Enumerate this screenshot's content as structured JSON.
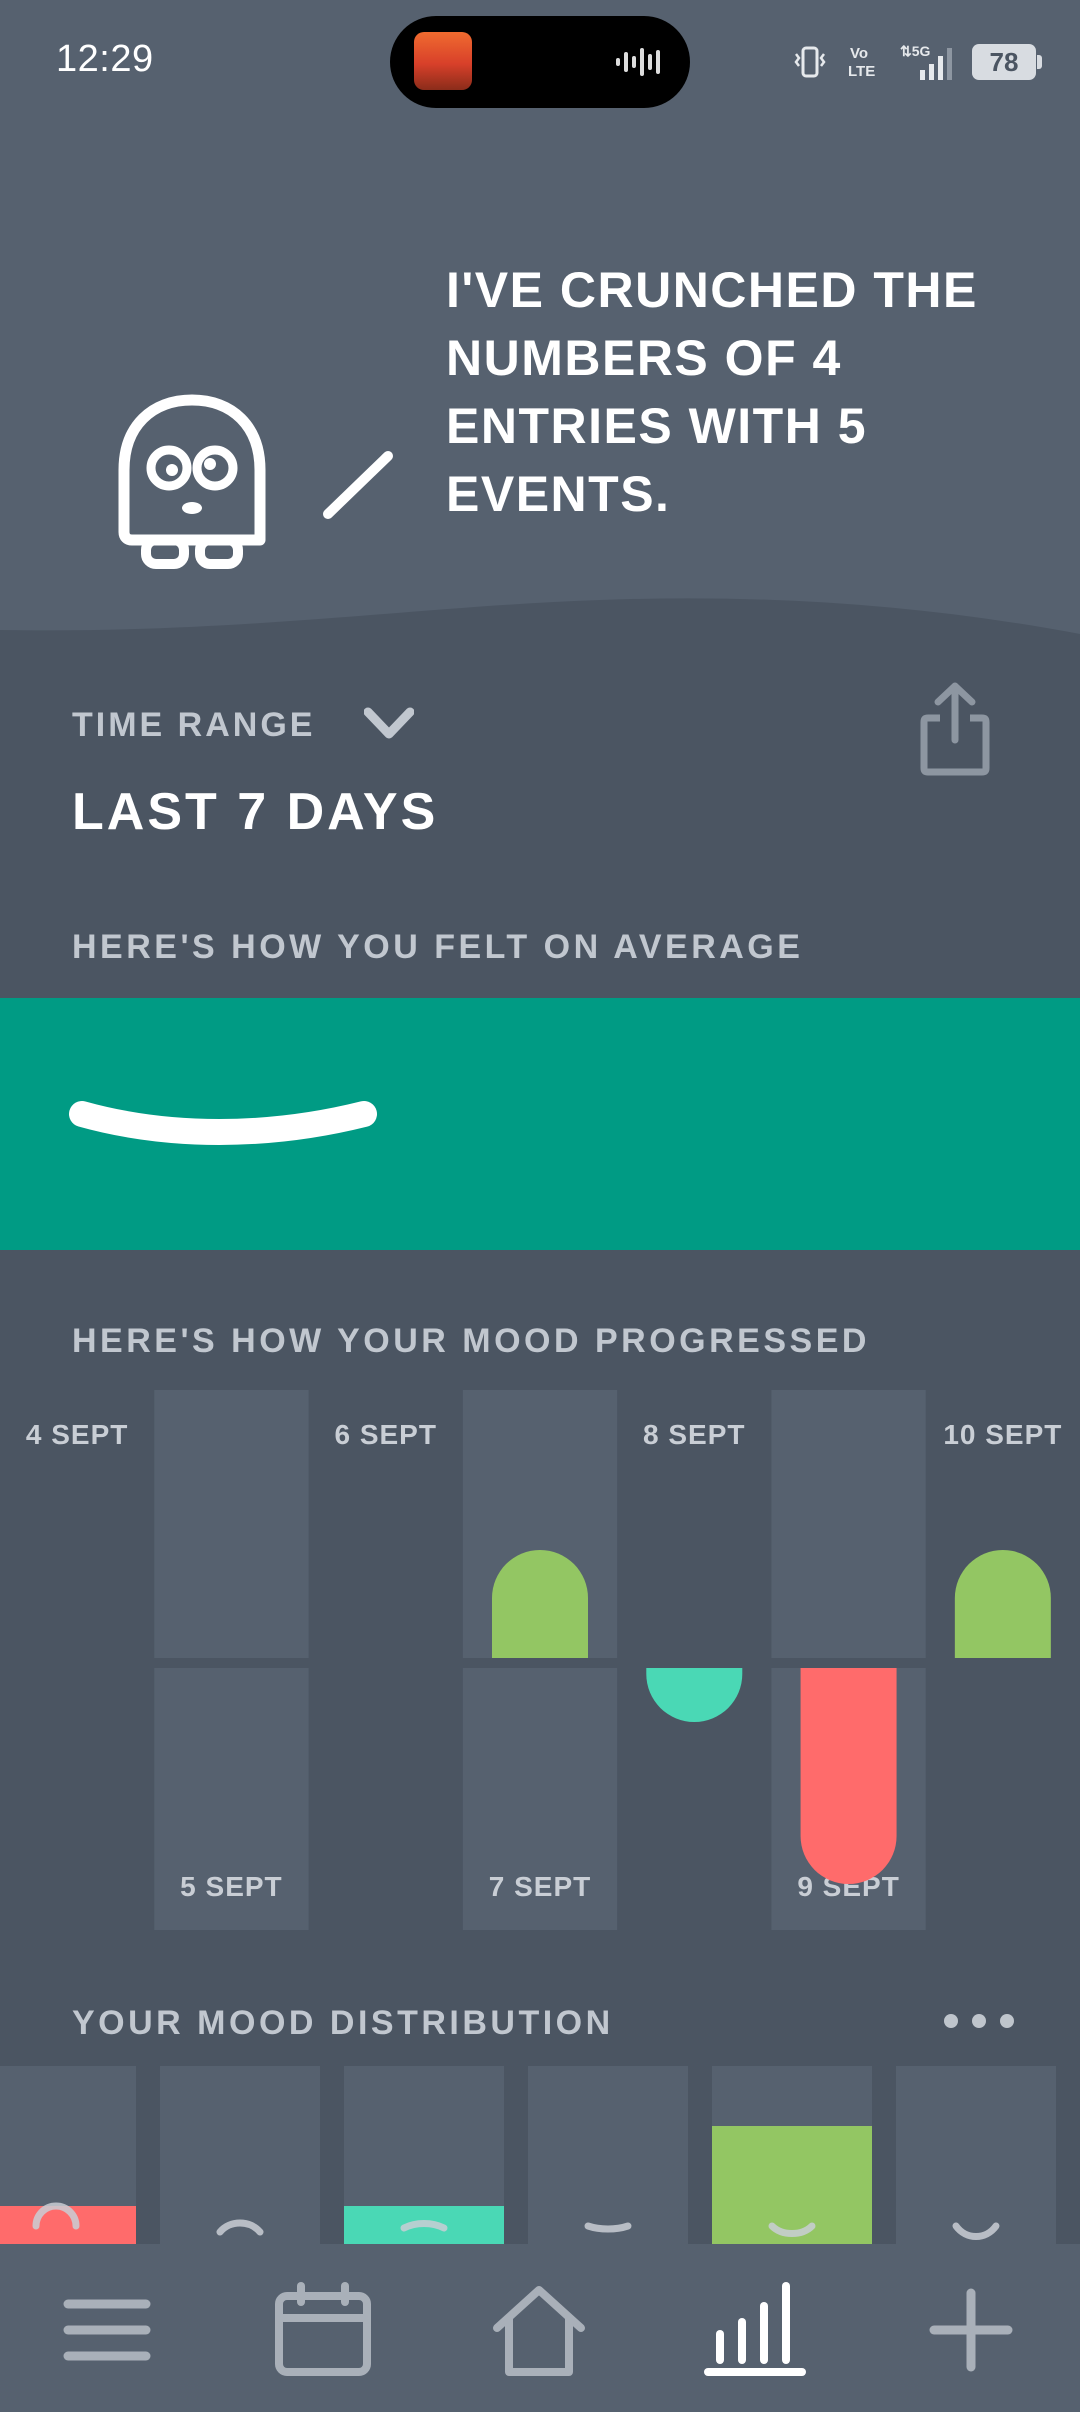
{
  "status_bar": {
    "time": "12:29",
    "battery": "78",
    "icons": [
      "vibrate-icon",
      "volte-icon",
      "5g-signal-icon",
      "battery-icon"
    ]
  },
  "header": {
    "message": "I'VE CRUNCHED THE NUMBERS OF 4 ENTRIES WITH 5 EVENTS.",
    "mascot": "ghost-mascot-icon"
  },
  "time_range": {
    "label": "TIME RANGE",
    "value": "LAST 7 DAYS"
  },
  "average": {
    "heading": "HERE'S HOW YOU FELT ON AVERAGE",
    "color": "#009b84",
    "mood_icon": "neutral-mouth-icon"
  },
  "progress": {
    "heading": "HERE'S HOW YOUR MOOD PROGRESSED"
  },
  "distribution": {
    "heading": "YOUR MOOD DISTRIBUTION"
  },
  "colors": {
    "good": "#93c663",
    "okay": "#4ad8b5",
    "bad": "#ff6b6b",
    "neutral_band": "#009b84"
  },
  "chart_data": [
    {
      "type": "bar",
      "categories": [
        "4 SEPT",
        "5 SEPT",
        "6 SEPT",
        "7 SEPT",
        "8 SEPT",
        "9 SEPT",
        "10 SEPT"
      ],
      "values": [
        null,
        null,
        null,
        1,
        -0.5,
        -2,
        1
      ],
      "colors": [
        null,
        null,
        null,
        "#93c663",
        "#4ad8b5",
        "#ff6b6b",
        "#93c663"
      ]
    },
    {
      "type": "bar",
      "categories": [
        "mood-1",
        "mood-2",
        "mood-3",
        "mood-4",
        "mood-5",
        "mood-6"
      ],
      "values": [
        1,
        0,
        1,
        0,
        3,
        0
      ],
      "colors": [
        "#ff6b6b",
        "#5a6572",
        "#4ad8b5",
        "#5a6572",
        "#93c663",
        "#5a6572"
      ]
    }
  ],
  "nav": {
    "items": [
      "menu-icon",
      "calendar-icon",
      "home-icon",
      "stats-icon",
      "add-icon"
    ],
    "active": "stats-icon"
  }
}
